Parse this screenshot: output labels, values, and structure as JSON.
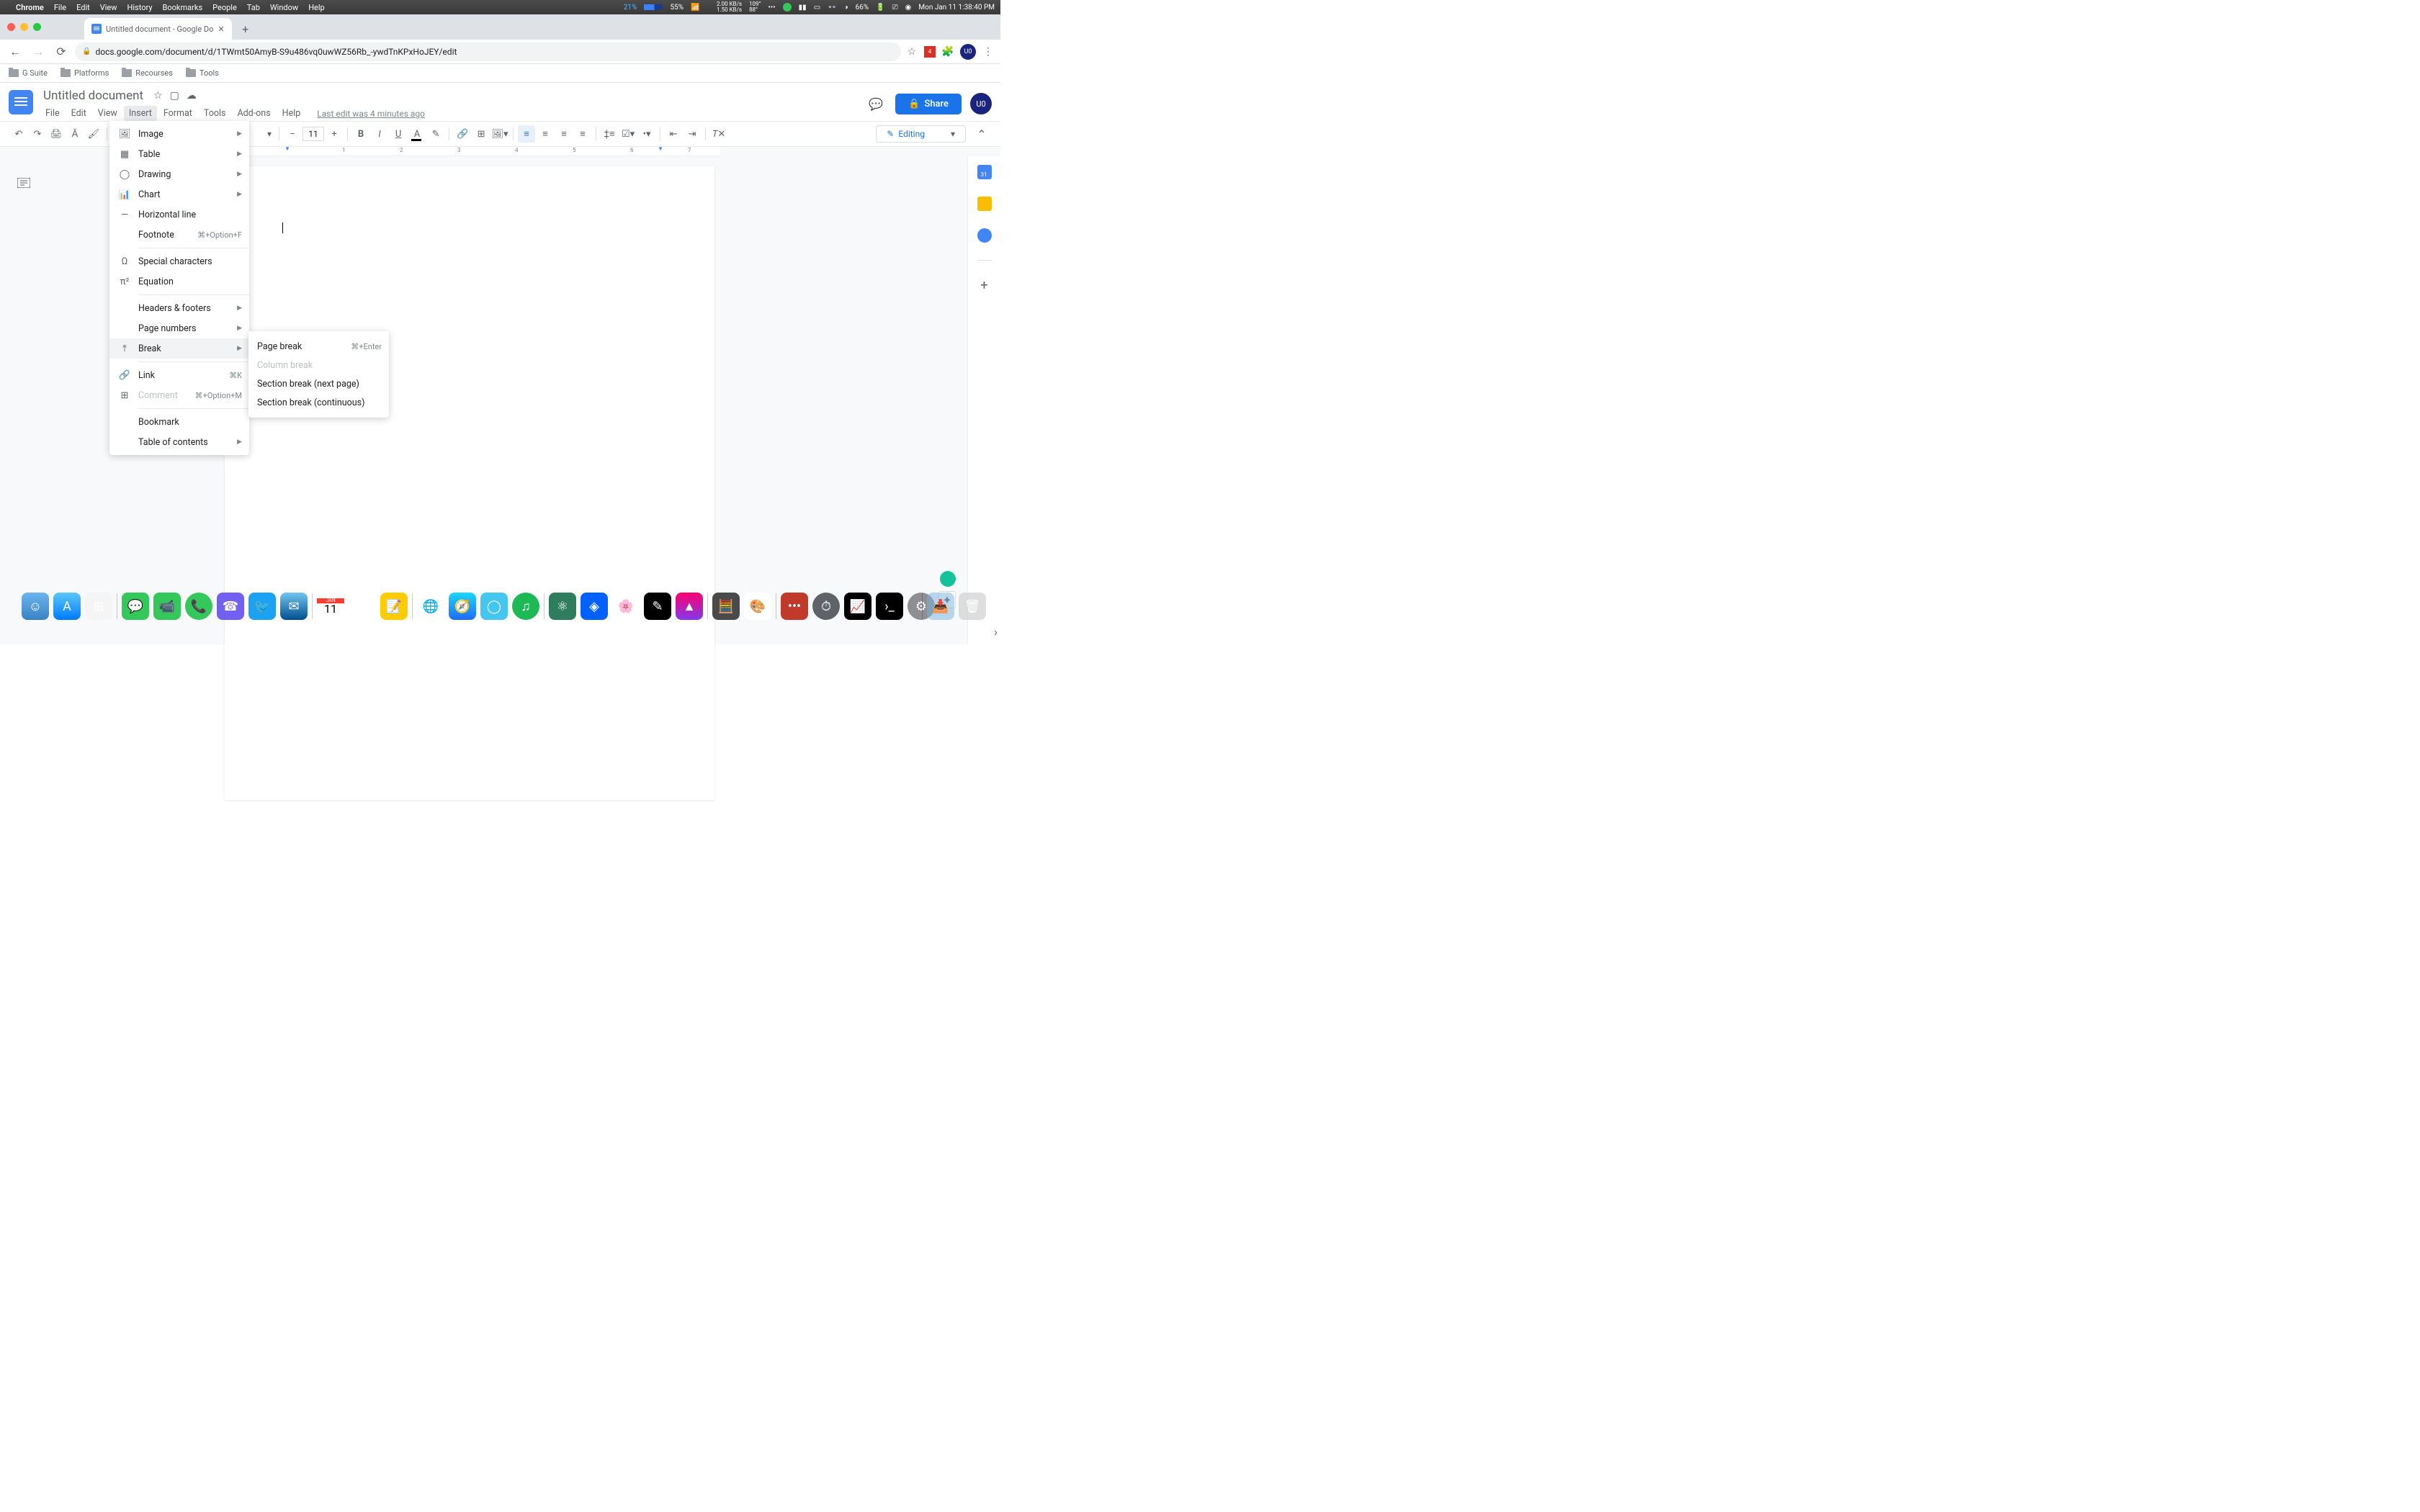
{
  "mac_menu": {
    "app": "Chrome",
    "items": [
      "File",
      "Edit",
      "View",
      "History",
      "Bookmarks",
      "People",
      "Tab",
      "Window",
      "Help"
    ],
    "cpu": "21%",
    "ram": "55%",
    "net_up": "2.00 KB/s",
    "net_down": "1.50 KB/s",
    "temp_hi": "109°",
    "temp_lo": "88°",
    "battery": "66%",
    "clock": "Mon Jan 11  1:38:40 PM"
  },
  "tab": {
    "title": "Untitled document - Google Do"
  },
  "address": {
    "url": "docs.google.com/document/d/1TWmt50AmyB-S9u486vq0uwWZ56Rb_-ywdTnKPxHoJEY/edit"
  },
  "profile_initials": "U0",
  "bookmarks": [
    "G Suite",
    "Platforms",
    "Recourses",
    "Tools"
  ],
  "doc": {
    "title": "Untitled document",
    "menus": [
      "File",
      "Edit",
      "View",
      "Insert",
      "Format",
      "Tools",
      "Add-ons",
      "Help"
    ],
    "active_menu_index": 3,
    "last_edit": "Last edit was 4 minutes ago",
    "share": "Share",
    "font_size": "11",
    "editing_mode": "Editing"
  },
  "insert_menu": {
    "items": [
      {
        "icon": "image",
        "label": "Image",
        "sub": true
      },
      {
        "icon": "table",
        "label": "Table",
        "sub": true
      },
      {
        "icon": "drawing",
        "label": "Drawing",
        "sub": true
      },
      {
        "icon": "chart",
        "label": "Chart",
        "sub": true
      },
      {
        "icon": "hr",
        "label": "Horizontal line"
      },
      {
        "icon": "",
        "label": "Footnote",
        "shortcut": "⌘+Option+F"
      },
      {
        "divider": true
      },
      {
        "icon": "omega",
        "label": "Special characters"
      },
      {
        "icon": "pi",
        "label": "Equation"
      },
      {
        "divider": true
      },
      {
        "icon": "",
        "label": "Headers & footers",
        "sub": true
      },
      {
        "icon": "",
        "label": "Page numbers",
        "sub": true
      },
      {
        "icon": "break",
        "label": "Break",
        "sub": true,
        "hover": true
      },
      {
        "divider": true
      },
      {
        "icon": "link",
        "label": "Link",
        "shortcut": "⌘K"
      },
      {
        "icon": "comment",
        "label": "Comment",
        "shortcut": "⌘+Option+M",
        "disabled": true
      },
      {
        "divider": true
      },
      {
        "icon": "",
        "label": "Bookmark"
      },
      {
        "icon": "",
        "label": "Table of contents",
        "sub": true
      }
    ]
  },
  "break_submenu": {
    "items": [
      {
        "label": "Page break",
        "shortcut": "⌘+Enter"
      },
      {
        "label": "Column break",
        "disabled": true
      },
      {
        "label": "Section break (next page)"
      },
      {
        "label": "Section break (continuous)"
      }
    ]
  },
  "ruler_marks": [
    "1",
    "2",
    "3",
    "4",
    "5",
    "6",
    "7"
  ],
  "dock": {
    "cal_day": "11",
    "cal_month": "JAN"
  }
}
